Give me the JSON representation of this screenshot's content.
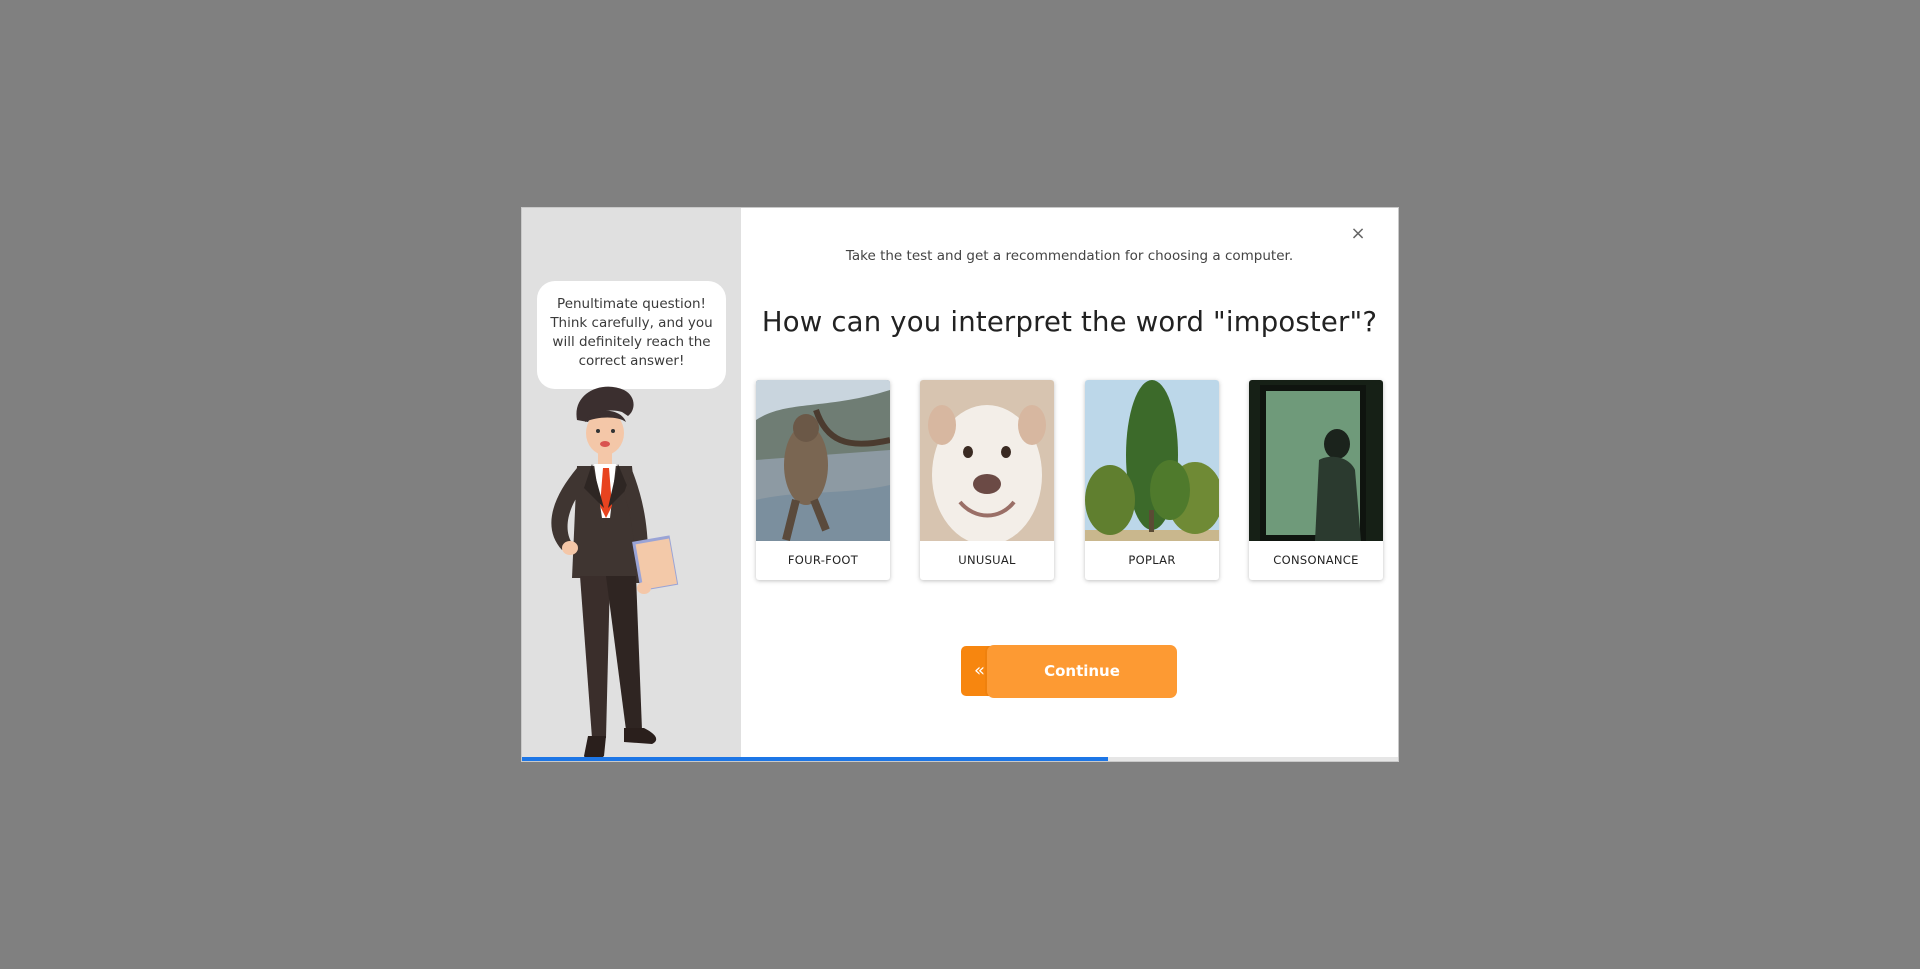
{
  "modal": {
    "close_label": "×",
    "subtitle": "Take the test and get a recommendation for choosing a computer.",
    "question": "How can you interpret the word \"imposter\"?",
    "bubble_text": "Penultimate question! Think carefully, and you will definitely reach the correct answer!",
    "options": [
      {
        "label": "FOUR-FOOT",
        "image": "creature-in-tree"
      },
      {
        "label": "UNUSUAL",
        "image": "smiling-dog"
      },
      {
        "label": "POPLAR",
        "image": "poplar-trees"
      },
      {
        "label": "CONSONANCE",
        "image": "person-at-window"
      }
    ],
    "back_label": "«",
    "continue_label": "Continue",
    "progress": 0.667
  },
  "colors": {
    "backdrop": "#808080",
    "accent_orange": "#fd9a33",
    "back_orange": "#f7860f",
    "progress_blue": "#1d76e6"
  }
}
